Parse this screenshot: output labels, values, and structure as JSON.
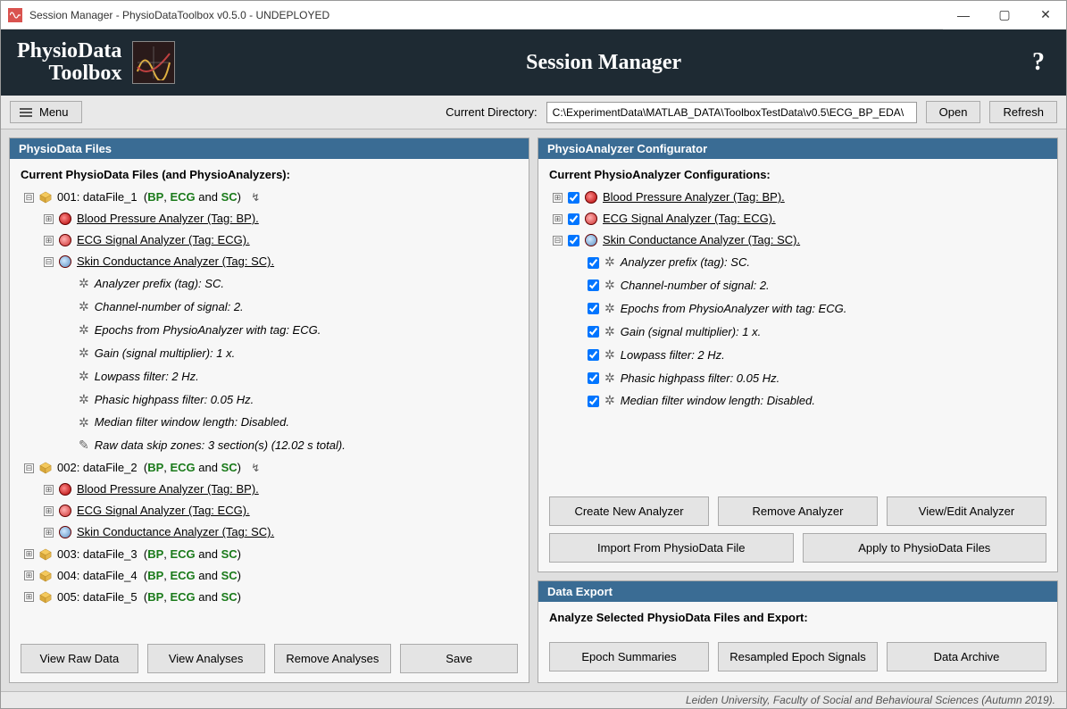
{
  "window": {
    "title": "Session Manager  -  PhysioDataToolbox v0.5.0  -  UNDEPLOYED"
  },
  "banner": {
    "logo_line1": "PhysioData",
    "logo_line2": "Toolbox",
    "title": "Session Manager"
  },
  "toolbar": {
    "menu": "Menu",
    "dir_label": "Current Directory:",
    "dir_value": "C:\\ExperimentData\\MATLAB_DATA\\ToolboxTestData\\v0.5\\ECG_BP_EDA\\",
    "open": "Open",
    "refresh": "Refresh"
  },
  "left_panel": {
    "header": "PhysioData Files",
    "section": "Current PhysioData Files (and PhysioAnalyzers):",
    "files": [
      {
        "idx": "001",
        "name": "dataFile_1",
        "tags": [
          "BP",
          "ECG",
          "SC"
        ],
        "open": true,
        "analyzers": [
          {
            "type": "bp",
            "label": "Blood Pressure Analyzer (Tag: BP).",
            "open": false
          },
          {
            "type": "ecg",
            "label": "ECG Signal Analyzer (Tag: ECG).",
            "open": false
          },
          {
            "type": "sc",
            "label": "Skin Conductance Analyzer (Tag: SC).",
            "open": true,
            "props": [
              "Analyzer prefix (tag): SC.",
              "Channel-number of signal: 2.",
              "Epochs from PhysioAnalyzer with tag: ECG.",
              "Gain (signal multiplier): 1 x.",
              "Lowpass filter: 2 Hz.",
              "Phasic highpass filter: 0.05 Hz.",
              "Median filter window length: Disabled."
            ],
            "rawskip": "Raw data skip zones: 3 section(s) (12.02 s total)."
          }
        ]
      },
      {
        "idx": "002",
        "name": "dataFile_2",
        "tags": [
          "BP",
          "ECG",
          "SC"
        ],
        "open": true,
        "analyzers": [
          {
            "type": "bp",
            "label": "Blood Pressure Analyzer (Tag: BP).",
            "open": false
          },
          {
            "type": "ecg",
            "label": "ECG Signal Analyzer (Tag: ECG).",
            "open": false
          },
          {
            "type": "sc",
            "label": "Skin Conductance Analyzer (Tag: SC).",
            "open": false
          }
        ]
      },
      {
        "idx": "003",
        "name": "dataFile_3",
        "tags": [
          "BP",
          "ECG",
          "SC"
        ],
        "open": false
      },
      {
        "idx": "004",
        "name": "dataFile_4",
        "tags": [
          "BP",
          "ECG",
          "SC"
        ],
        "open": false
      },
      {
        "idx": "005",
        "name": "dataFile_5",
        "tags": [
          "BP",
          "ECG",
          "SC"
        ],
        "open": false
      }
    ],
    "buttons": {
      "viewraw": "View Raw Data",
      "viewan": "View Analyses",
      "removean": "Remove Analyses",
      "save": "Save"
    }
  },
  "cfg_panel": {
    "header": "PhysioAnalyzer Configurator",
    "section": "Current PhysioAnalyzer Configurations:",
    "analyzers": [
      {
        "type": "bp",
        "label": "Blood Pressure Analyzer (Tag: BP).",
        "open": false,
        "checked": true
      },
      {
        "type": "ecg",
        "label": "ECG Signal Analyzer (Tag: ECG).",
        "open": false,
        "checked": true
      },
      {
        "type": "sc",
        "label": "Skin Conductance Analyzer (Tag: SC).",
        "open": true,
        "checked": true,
        "props": [
          {
            "t": "Analyzer prefix (tag): SC.",
            "c": true
          },
          {
            "t": "Channel-number of signal: 2.",
            "c": true
          },
          {
            "t": "Epochs from PhysioAnalyzer with tag: ECG.",
            "c": true
          },
          {
            "t": "Gain (signal multiplier): 1 x.",
            "c": true
          },
          {
            "t": "Lowpass filter: 2 Hz.",
            "c": true
          },
          {
            "t": "Phasic highpass filter: 0.05 Hz.",
            "c": true
          },
          {
            "t": "Median filter window length: Disabled.",
            "c": true
          }
        ]
      }
    ],
    "buttons": {
      "create": "Create New Analyzer",
      "remove": "Remove Analyzer",
      "view": "View/Edit Analyzer",
      "import": "Import From PhysioData File",
      "apply": "Apply to PhysioData Files"
    }
  },
  "export_panel": {
    "header": "Data Export",
    "section": "Analyze Selected PhysioData Files and Export:",
    "buttons": {
      "epoch": "Epoch Summaries",
      "resampled": "Resampled Epoch Signals",
      "archive": "Data Archive"
    }
  },
  "footer": "Leiden University, Faculty of Social and Behavioural Sciences (Autumn 2019)."
}
